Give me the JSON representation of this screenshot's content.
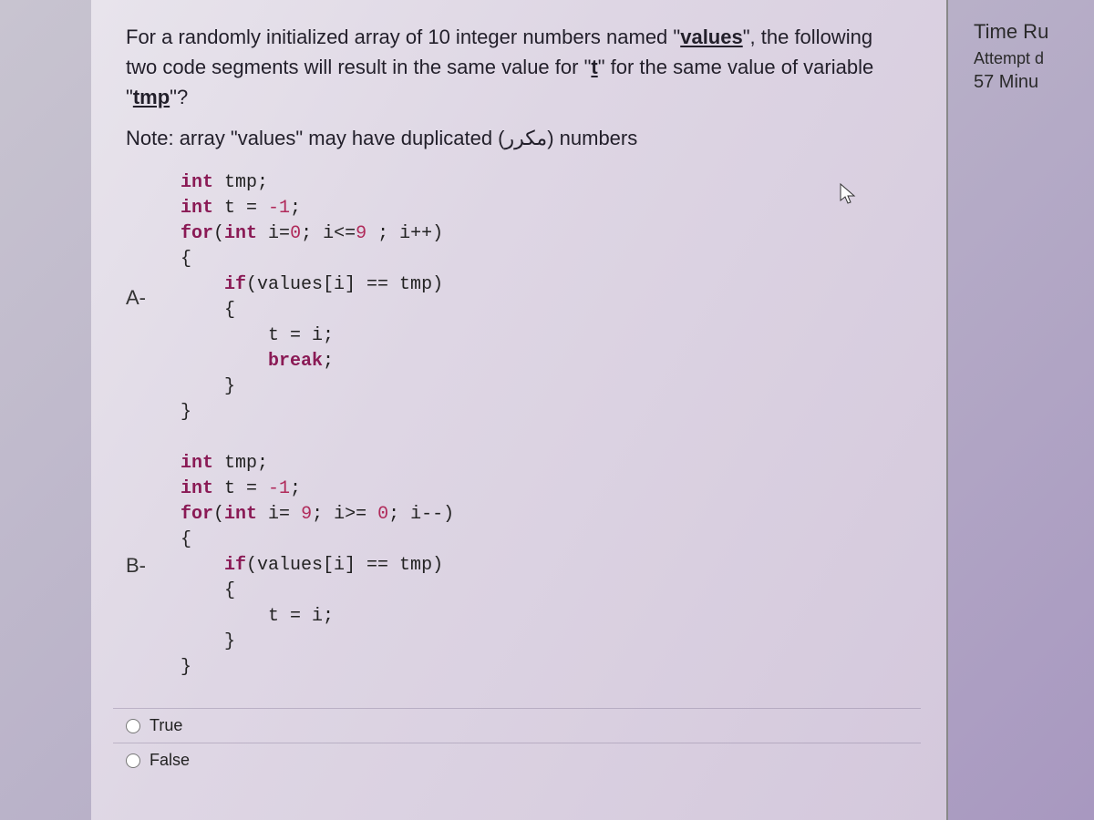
{
  "question": {
    "line1_a": "For a randomly initialized array of 10 integer numbers named \"",
    "line1_b": "values",
    "line1_c": "\", the following",
    "line2_a": "two code segments will result in the same value for \"",
    "line2_b": "t",
    "line2_c": "\" for the same value of variable",
    "line3_a": "\"",
    "line3_b": "tmp",
    "line3_c": "\"?",
    "note": "Note: array \"values\" may have duplicated (مكرر) numbers"
  },
  "labels": {
    "a": "A-",
    "b": "B-"
  },
  "code_a": {
    "l1a": "int",
    "l1b": " tmp;",
    "l2a": "int",
    "l2b": " t = ",
    "l2c": "-1",
    "l2d": ";",
    "l3a": "for",
    "l3b": "(",
    "l3c": "int",
    "l3d": " i=",
    "l3e": "0",
    "l3f": "; i<=",
    "l3g": "9",
    "l3h": " ; i++)",
    "l4": "{",
    "l5a": "    ",
    "l5b": "if",
    "l5c": "(values[i] == tmp)",
    "l6": "    {",
    "l7": "        t = i;",
    "l8a": "        ",
    "l8b": "break",
    "l8c": ";",
    "l9": "    }",
    "l10": "}"
  },
  "code_b": {
    "l1a": "int",
    "l1b": " tmp;",
    "l2a": "int",
    "l2b": " t = ",
    "l2c": "-1",
    "l2d": ";",
    "l3a": "for",
    "l3b": "(",
    "l3c": "int",
    "l3d": " i= ",
    "l3e": "9",
    "l3f": "; i>= ",
    "l3g": "0",
    "l3h": "; i--)",
    "l4": "{",
    "l5a": "    ",
    "l5b": "if",
    "l5c": "(values[i] == tmp)",
    "l6": "    {",
    "l7": "        t = i;",
    "l8": "    }",
    "l9": "}"
  },
  "answers": {
    "true": "True",
    "false": "False"
  },
  "side": {
    "title": "Time Ru",
    "attempt": "Attempt d",
    "time": "57 Minu"
  }
}
